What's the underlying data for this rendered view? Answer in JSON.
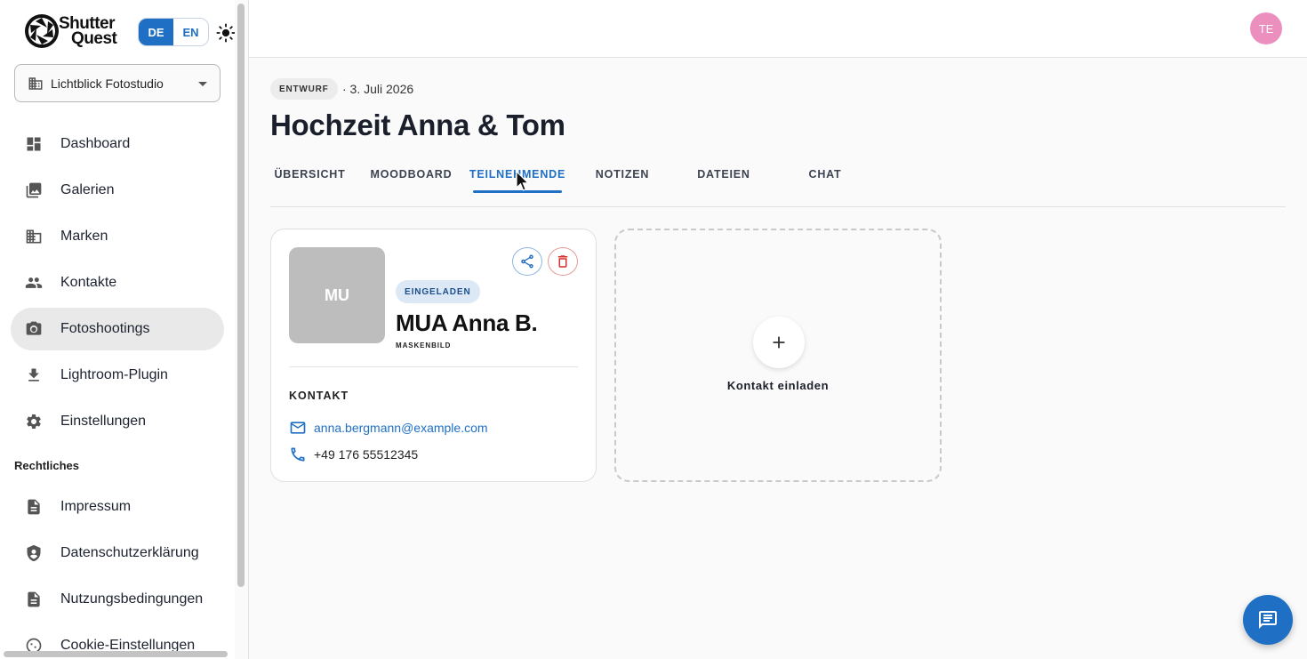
{
  "app": {
    "logo_line1": "Shutter",
    "logo_line2": "Quest",
    "languages": [
      "DE",
      "EN"
    ],
    "active_language": "DE"
  },
  "studio_select": {
    "value": "Lichtblick Fotostudio"
  },
  "sidebar": {
    "items": [
      {
        "label": "Dashboard",
        "icon": "dashboard-icon"
      },
      {
        "label": "Galerien",
        "icon": "photo-library-icon"
      },
      {
        "label": "Marken",
        "icon": "building-icon"
      },
      {
        "label": "Kontakte",
        "icon": "people-icon"
      },
      {
        "label": "Fotoshootings",
        "icon": "camera-icon",
        "active": true
      },
      {
        "label": "Lightroom-Plugin",
        "icon": "download-icon"
      },
      {
        "label": "Einstellungen",
        "icon": "gear-icon"
      }
    ],
    "legal_title": "Rechtliches",
    "legal_items": [
      {
        "label": "Impressum",
        "icon": "document-icon"
      },
      {
        "label": "Datenschutzerklärung",
        "icon": "shield-icon"
      },
      {
        "label": "Nutzungsbedingungen",
        "icon": "document-icon"
      },
      {
        "label": "Cookie-Einstellungen",
        "icon": "cookie-icon"
      }
    ]
  },
  "topbar": {
    "avatar_initials": "TE",
    "avatar_color": "#ea8fbe"
  },
  "shoot": {
    "status": "ENTWURF",
    "date": "· 3. Juli 2026",
    "title": "Hochzeit Anna & Tom"
  },
  "tabs": [
    {
      "label": "ÜBERSICHT"
    },
    {
      "label": "MOODBOARD"
    },
    {
      "label": "TEILNEHMENDE",
      "active": true
    },
    {
      "label": "NOTIZEN"
    },
    {
      "label": "DATEIEN"
    },
    {
      "label": "CHAT"
    }
  ],
  "participant": {
    "initials": "MU",
    "status": "EINGELADEN",
    "name": "MUA Anna B.",
    "role": "MASKENBILD",
    "contact_title": "KONTAKT",
    "email": "anna.bergmann@example.com",
    "phone": "+49 176 55512345"
  },
  "invite": {
    "label": "Kontakt einladen"
  },
  "colors": {
    "accent": "#1f6fc5",
    "danger": "#d32f2f",
    "status_badge_bg": "#dde8f6"
  }
}
